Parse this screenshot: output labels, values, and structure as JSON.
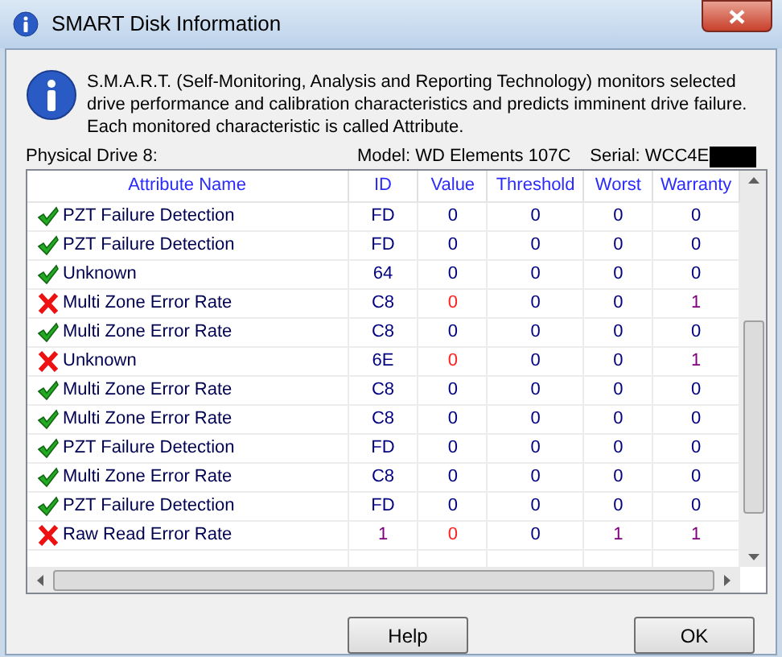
{
  "window": {
    "title": "SMART Disk Information"
  },
  "intro": "S.M.A.R.T. (Self-Monitoring, Analysis and Reporting Technology) monitors selected drive performance and calibration characteristics and predicts imminent drive failure. Each monitored characteristic is called Attribute.",
  "drive": "Physical Drive 8:",
  "model": "Model: WD Elements 107C",
  "serial": "Serial: WCC4E",
  "table": {
    "columns": [
      "Attribute Name",
      "ID",
      "Value",
      "Threshold",
      "Worst",
      "Warranty"
    ],
    "rows": [
      {
        "failed": false,
        "cells": [
          {
            "text": "PZT Failure Detection",
            "alert": false,
            "warn": false
          },
          {
            "text": "FD",
            "alert": false,
            "warn": false
          },
          {
            "text": "0",
            "alert": false,
            "warn": false
          },
          {
            "text": "0",
            "alert": false,
            "warn": false
          },
          {
            "text": "0",
            "alert": false,
            "warn": false
          },
          {
            "text": "0",
            "alert": false,
            "warn": false
          }
        ]
      },
      {
        "failed": false,
        "cells": [
          {
            "text": "PZT Failure Detection",
            "alert": false,
            "warn": false
          },
          {
            "text": "FD",
            "alert": false,
            "warn": false
          },
          {
            "text": "0",
            "alert": false,
            "warn": false
          },
          {
            "text": "0",
            "alert": false,
            "warn": false
          },
          {
            "text": "0",
            "alert": false,
            "warn": false
          },
          {
            "text": "0",
            "alert": false,
            "warn": false
          }
        ]
      },
      {
        "failed": false,
        "cells": [
          {
            "text": "Unknown",
            "alert": false,
            "warn": false
          },
          {
            "text": "64",
            "alert": false,
            "warn": false
          },
          {
            "text": "0",
            "alert": false,
            "warn": false
          },
          {
            "text": "0",
            "alert": false,
            "warn": false
          },
          {
            "text": "0",
            "alert": false,
            "warn": false
          },
          {
            "text": "0",
            "alert": false,
            "warn": false
          }
        ]
      },
      {
        "failed": true,
        "cells": [
          {
            "text": "Multi Zone Error Rate",
            "alert": false,
            "warn": false
          },
          {
            "text": "C8",
            "alert": false,
            "warn": false
          },
          {
            "text": "0",
            "alert": true,
            "warn": false
          },
          {
            "text": "0",
            "alert": false,
            "warn": false
          },
          {
            "text": "0",
            "alert": false,
            "warn": false
          },
          {
            "text": "1",
            "alert": false,
            "warn": true
          }
        ]
      },
      {
        "failed": false,
        "cells": [
          {
            "text": "Multi Zone Error Rate",
            "alert": false,
            "warn": false
          },
          {
            "text": "C8",
            "alert": false,
            "warn": false
          },
          {
            "text": "0",
            "alert": false,
            "warn": false
          },
          {
            "text": "0",
            "alert": false,
            "warn": false
          },
          {
            "text": "0",
            "alert": false,
            "warn": false
          },
          {
            "text": "0",
            "alert": false,
            "warn": false
          }
        ]
      },
      {
        "failed": true,
        "cells": [
          {
            "text": "Unknown",
            "alert": false,
            "warn": false
          },
          {
            "text": "6E",
            "alert": false,
            "warn": false
          },
          {
            "text": "0",
            "alert": true,
            "warn": false
          },
          {
            "text": "0",
            "alert": false,
            "warn": false
          },
          {
            "text": "0",
            "alert": false,
            "warn": false
          },
          {
            "text": "1",
            "alert": false,
            "warn": true
          }
        ]
      },
      {
        "failed": false,
        "cells": [
          {
            "text": "Multi Zone Error Rate",
            "alert": false,
            "warn": false
          },
          {
            "text": "C8",
            "alert": false,
            "warn": false
          },
          {
            "text": "0",
            "alert": false,
            "warn": false
          },
          {
            "text": "0",
            "alert": false,
            "warn": false
          },
          {
            "text": "0",
            "alert": false,
            "warn": false
          },
          {
            "text": "0",
            "alert": false,
            "warn": false
          }
        ]
      },
      {
        "failed": false,
        "cells": [
          {
            "text": "Multi Zone Error Rate",
            "alert": false,
            "warn": false
          },
          {
            "text": "C8",
            "alert": false,
            "warn": false
          },
          {
            "text": "0",
            "alert": false,
            "warn": false
          },
          {
            "text": "0",
            "alert": false,
            "warn": false
          },
          {
            "text": "0",
            "alert": false,
            "warn": false
          },
          {
            "text": "0",
            "alert": false,
            "warn": false
          }
        ]
      },
      {
        "failed": false,
        "cells": [
          {
            "text": "PZT Failure Detection",
            "alert": false,
            "warn": false
          },
          {
            "text": "FD",
            "alert": false,
            "warn": false
          },
          {
            "text": "0",
            "alert": false,
            "warn": false
          },
          {
            "text": "0",
            "alert": false,
            "warn": false
          },
          {
            "text": "0",
            "alert": false,
            "warn": false
          },
          {
            "text": "0",
            "alert": false,
            "warn": false
          }
        ]
      },
      {
        "failed": false,
        "cells": [
          {
            "text": "Multi Zone Error Rate",
            "alert": false,
            "warn": false
          },
          {
            "text": "C8",
            "alert": false,
            "warn": false
          },
          {
            "text": "0",
            "alert": false,
            "warn": false
          },
          {
            "text": "0",
            "alert": false,
            "warn": false
          },
          {
            "text": "0",
            "alert": false,
            "warn": false
          },
          {
            "text": "0",
            "alert": false,
            "warn": false
          }
        ]
      },
      {
        "failed": false,
        "cells": [
          {
            "text": "PZT Failure Detection",
            "alert": false,
            "warn": false
          },
          {
            "text": "FD",
            "alert": false,
            "warn": false
          },
          {
            "text": "0",
            "alert": false,
            "warn": false
          },
          {
            "text": "0",
            "alert": false,
            "warn": false
          },
          {
            "text": "0",
            "alert": false,
            "warn": false
          },
          {
            "text": "0",
            "alert": false,
            "warn": false
          }
        ]
      },
      {
        "failed": true,
        "cells": [
          {
            "text": "Raw Read Error Rate",
            "alert": false,
            "warn": false
          },
          {
            "text": "1",
            "alert": false,
            "warn": true
          },
          {
            "text": "0",
            "alert": true,
            "warn": false
          },
          {
            "text": "0",
            "alert": false,
            "warn": false
          },
          {
            "text": "1",
            "alert": false,
            "warn": true
          },
          {
            "text": "1",
            "alert": false,
            "warn": true
          }
        ]
      }
    ]
  },
  "buttons": [
    "Help",
    "OK"
  ]
}
